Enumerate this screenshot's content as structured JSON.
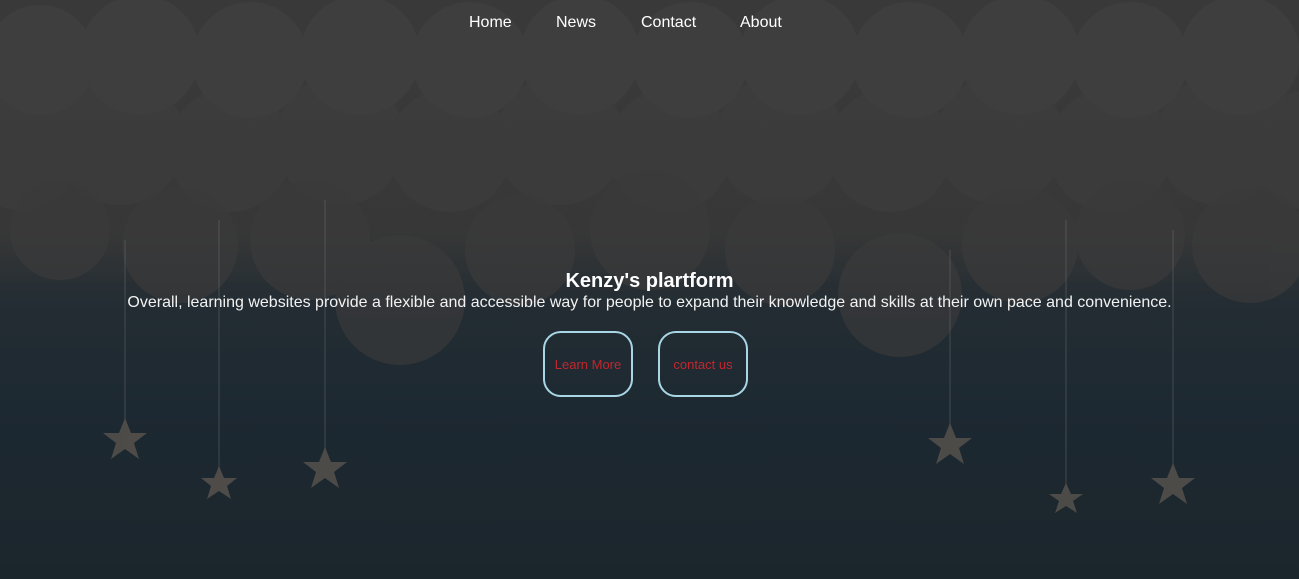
{
  "nav": {
    "items": [
      {
        "label": "Home"
      },
      {
        "label": "News"
      },
      {
        "label": "Contact"
      },
      {
        "label": "About"
      }
    ]
  },
  "hero": {
    "title": "Kenzy's plartform",
    "subtitle": "Overall, learning websites provide a flexible and accessible way for people to expand their knowledge and skills at their own pace and convenience."
  },
  "buttons": {
    "learn_more": "Learn More",
    "contact_us": "contact us"
  },
  "colors": {
    "button_border": "#a9d6e5",
    "button_text": "#c1272d",
    "nav_text": "#ffffff"
  }
}
